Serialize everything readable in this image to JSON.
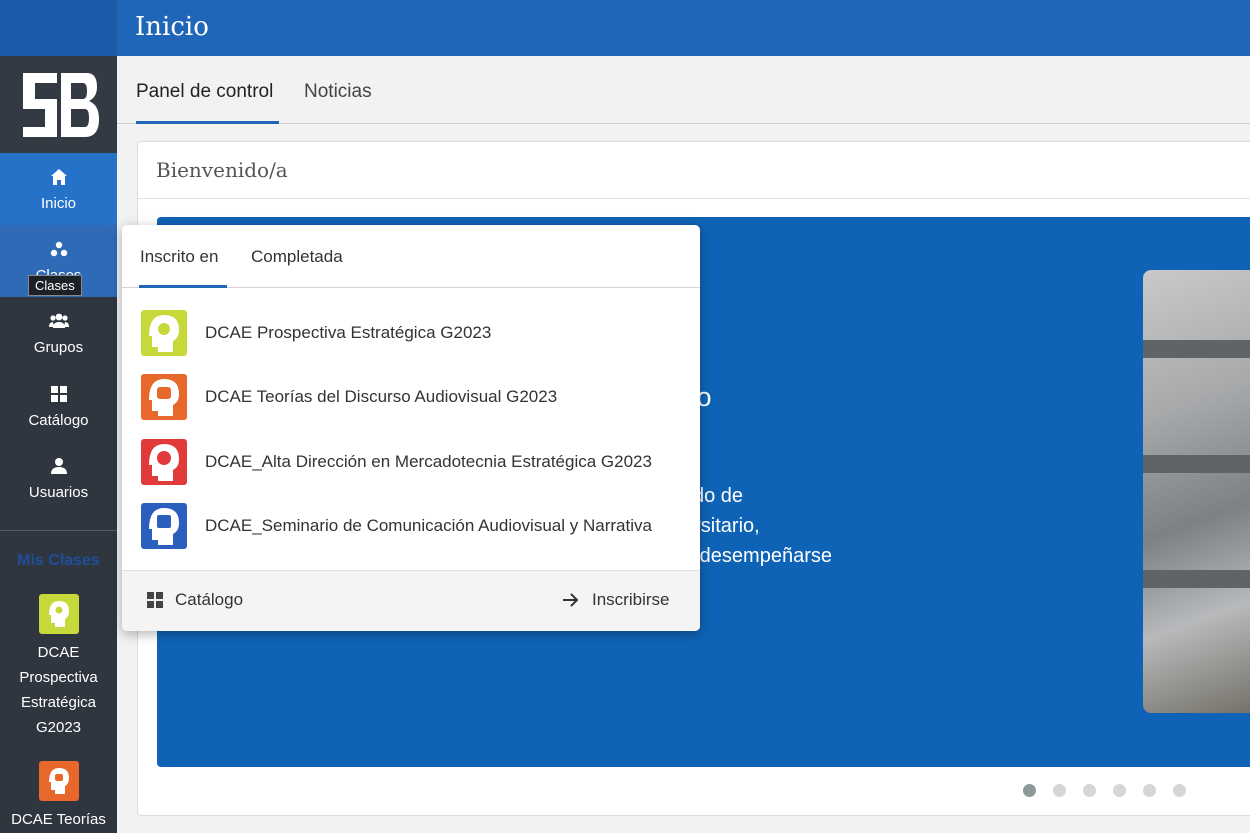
{
  "header": {
    "title": "Inicio"
  },
  "sidebar": {
    "logo_alt": "SB",
    "items": [
      {
        "label": "Inicio",
        "icon": "home-icon"
      },
      {
        "label": "Clases",
        "icon": "classes-icon"
      },
      {
        "label": "Grupos",
        "icon": "groups-icon"
      },
      {
        "label": "Catálogo",
        "icon": "grid-icon"
      },
      {
        "label": "Usuarios",
        "icon": "user-icon"
      }
    ],
    "tooltip": "Clases",
    "mis_clases_label": "Mis Clases",
    "classes": [
      {
        "label": "DCAE Prospectiva Estratégica G2023",
        "color": "#c6d83a"
      },
      {
        "label": "DCAE Teorías",
        "color": "#e8672a"
      }
    ]
  },
  "tabs": [
    {
      "label": "Panel de control"
    },
    {
      "label": "Noticias"
    }
  ],
  "card": {
    "welcome": "Bienvenido/a",
    "banner_title": "co",
    "banner_text": "tido de\nersitario,\nn desempeñarse"
  },
  "popup": {
    "tabs": [
      {
        "label": "Inscrito en"
      },
      {
        "label": "Completada"
      }
    ],
    "rows": [
      {
        "label": "DCAE Prospectiva Estratégica G2023",
        "color": "#c6d83a"
      },
      {
        "label": "DCAE Teorías del Discurso Audiovisual G2023",
        "color": "#e8672a"
      },
      {
        "label": "DCAE_Alta Dirección en Mercadotecnia Estratégica G2023",
        "color": "#e03a3a"
      },
      {
        "label": "DCAE_Seminario de Comunicación Audiovisual y Narrativa",
        "color": "#2a5fbf"
      }
    ],
    "footer": {
      "catalog": "Catálogo",
      "enroll": "Inscribirse"
    }
  },
  "colors": {
    "primary": "#1f66b8",
    "sidebar": "#2f3640"
  }
}
